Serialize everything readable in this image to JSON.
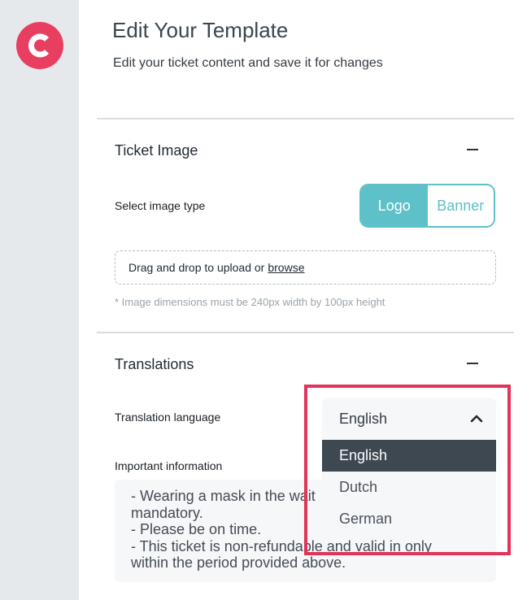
{
  "app": {
    "logo_letter": "C"
  },
  "header": {
    "title": "Edit Your Template",
    "subtitle": "Edit your ticket content and save it for changes"
  },
  "ticket_image": {
    "title": "Ticket Image",
    "image_type_label": "Select image type",
    "options": [
      "Logo",
      "Banner"
    ],
    "selected": "Logo",
    "dropzone_text": "Drag and drop to upload or",
    "browse_label": "browse",
    "hint": "* Image dimensions must be 240px width by 100px height"
  },
  "translations": {
    "title": "Translations",
    "language_label": "Translation language",
    "selected_language": "English",
    "language_options": [
      "English",
      "Dutch",
      "German"
    ],
    "important_info_label": "Important information",
    "important_info_lines": [
      "- Wearing a mask in the wait",
      "mandatory.",
      "- Please be on time.",
      "- This ticket is non-refundable and valid in only",
      "within the period provided above."
    ]
  },
  "colors": {
    "brand": "#e83e5f",
    "accent": "#5ec0c9",
    "highlight": "#e0345a",
    "selected_item": "#3d4851"
  },
  "icons": {
    "logo": "brand-c-logo-icon",
    "collapse": "minus-icon",
    "dropdown": "chevron-up-icon"
  }
}
